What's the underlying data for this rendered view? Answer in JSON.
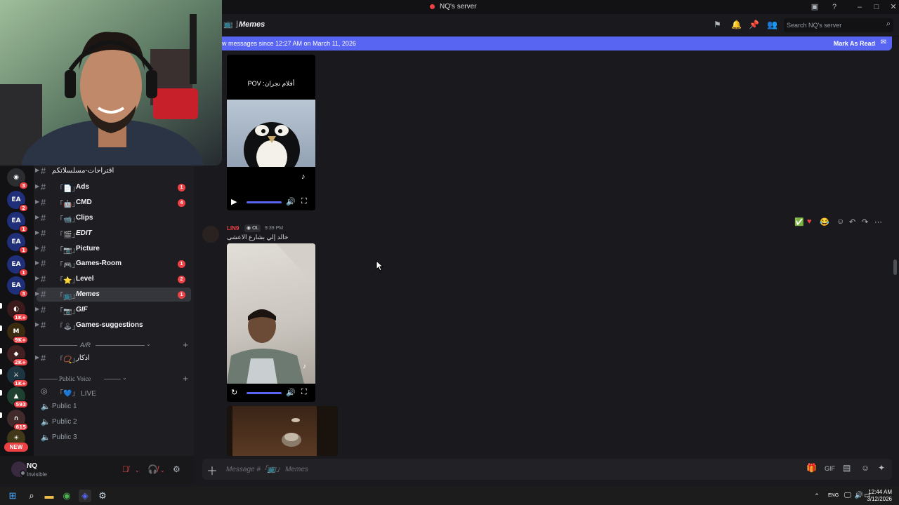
{
  "window": {
    "title": "NQ's server"
  },
  "header": {
    "channel_name": "Memes",
    "search_placeholder": "Search NQ's server"
  },
  "new_messages_bar": {
    "text": "w messages since 12:27 AM on March 11, 2026",
    "mark_as_read": "Mark As Read"
  },
  "server_rail": {
    "badges": [
      "3",
      "2",
      "1",
      "1",
      "1",
      "3",
      "1K+",
      "9K+",
      "2K+",
      "1K+",
      "593",
      "615"
    ],
    "new_label": "NEW",
    "icon_labels": [
      "EA",
      "EA",
      "EA",
      "EA",
      "EA"
    ]
  },
  "sidebar": {
    "channels": [
      {
        "name": "اقتراحات-مسلسلاتكم",
        "deco": "",
        "badge": ""
      },
      {
        "name": "Ads",
        "deco": "「📄」",
        "badge": "1"
      },
      {
        "name": "CMD",
        "deco": "「🤖」",
        "badge": "4"
      },
      {
        "name": "Clips",
        "deco": "「📹」",
        "badge": ""
      },
      {
        "name": "EDIT",
        "deco": "「🎬」",
        "badge": ""
      },
      {
        "name": "Picture",
        "deco": "「📷」",
        "badge": ""
      },
      {
        "name": "Games-Room",
        "deco": "「🎮」",
        "badge": "1"
      },
      {
        "name": "Level",
        "deco": "「⭐」",
        "badge": "2"
      },
      {
        "name": "Memes",
        "deco": "「📺」",
        "badge": "1"
      },
      {
        "name": "GIF",
        "deco": "「📷」",
        "badge": ""
      },
      {
        "name": "Games-suggestions",
        "deco": "「🕹」",
        "badge": ""
      }
    ],
    "categories": {
      "afk": "A/R",
      "public_voice": "Public Voice"
    },
    "azkar_channel": {
      "name": "اذكار",
      "deco": "「📿」"
    },
    "voice_channels": [
      {
        "name": "「💙」 LIVE"
      },
      {
        "name": "Public 1"
      },
      {
        "name": "Public 2"
      },
      {
        "name": "Public 3"
      }
    ]
  },
  "user_panel": {
    "username": "NQ",
    "status": "Invisible"
  },
  "messages": {
    "video1_caption": "POV :أفلام نجران",
    "msg2": {
      "author": "LIN9",
      "tag": "OL",
      "time": "9:39 PM",
      "text": "خالد إلي بشارع الاعشى"
    }
  },
  "composer": {
    "placeholder": "Message #「📺」 Memes"
  },
  "taskbar": {
    "lang": "ENG",
    "time": "12:44 AM",
    "date": "3/12/2026"
  }
}
